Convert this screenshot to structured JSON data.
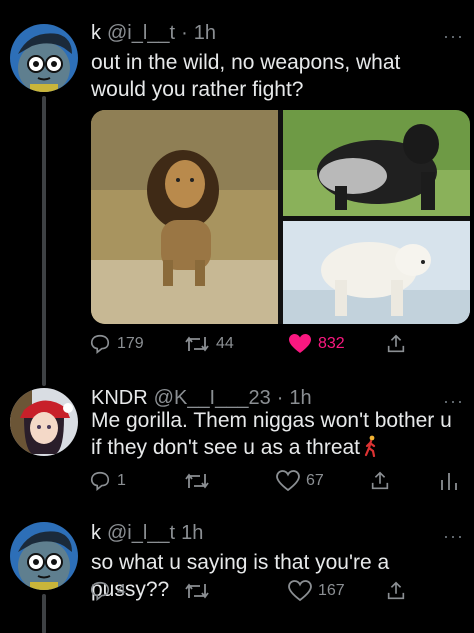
{
  "tweets": [
    {
      "name": "k",
      "handle": "@i_l__t",
      "dot": "·",
      "time": "1h",
      "text": "out in the wild, no weapons, what would you rather fight?",
      "more": "···",
      "media": [
        {
          "label": "lion-photo"
        },
        {
          "label": "gorilla-photo"
        },
        {
          "label": "polar-bear-photo"
        }
      ],
      "actions": {
        "replies": "179",
        "retweets": "44",
        "likes": "832"
      }
    },
    {
      "name": "KNDR",
      "handle": "@K__I___23",
      "dot": "·",
      "time": "1h",
      "text": "Me gorilla. Them niggas won't bother u if they don't see u as a threat",
      "more": "···",
      "actions": {
        "replies": "1",
        "retweets": "",
        "likes": "67"
      }
    },
    {
      "name": "k",
      "handle": "@i_l__t",
      "dot": "",
      "time": "1h",
      "text": "so what u saying is that you're a pussy??",
      "more": "···",
      "actions": {
        "replies": "4",
        "retweets": "",
        "likes": "167"
      }
    }
  ],
  "colors": {
    "background": "#000000",
    "text": "#e7e9ea",
    "muted": "#8b8f93",
    "like": "#f91880",
    "thread_line": "#3e4144"
  },
  "icons": [
    "reply-icon",
    "retweet-icon",
    "heart-icon",
    "share-icon",
    "analytics-icon",
    "more-icon"
  ]
}
